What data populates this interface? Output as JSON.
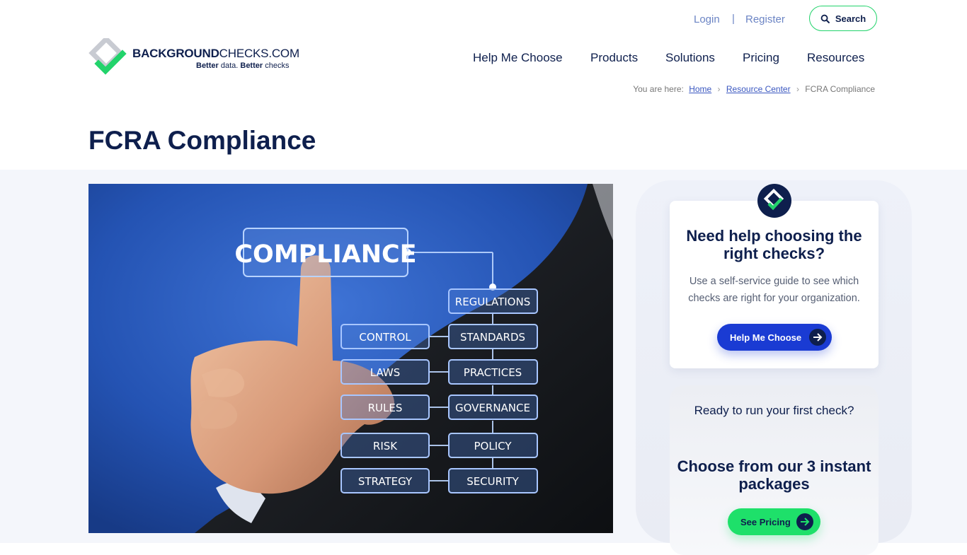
{
  "header": {
    "login_label": "Login",
    "separator": "|",
    "register_label": "Register",
    "search_label": "Search",
    "search_icon": "search-icon"
  },
  "logo": {
    "brand_bold": "BACKGROUND",
    "brand_light": "CHECKS.COM",
    "tagline_a": "Better",
    "tagline_b": " data. ",
    "tagline_c": "Better",
    "tagline_d": " checks",
    "colors": {
      "navy": "#0e1f4d",
      "green": "#22d36b",
      "grey": "#c8cbd2"
    }
  },
  "nav": {
    "items": [
      {
        "label": "Help Me Choose"
      },
      {
        "label": "Products"
      },
      {
        "label": "Solutions"
      },
      {
        "label": "Pricing"
      },
      {
        "label": "Resources"
      }
    ]
  },
  "breadcrumb": {
    "prefix": "You are here:",
    "home": "Home",
    "resource_center": "Resource Center",
    "current": "FCRA Compliance",
    "chevron": "›"
  },
  "page": {
    "title": "FCRA Compliance"
  },
  "hero": {
    "main_label": "COMPLIANCE",
    "left_column": [
      "CONTROL",
      "LAWS",
      "RULES",
      "RISK",
      "STRATEGY"
    ],
    "right_column": [
      "REGULATIONS",
      "STANDARDS",
      "PRACTICES",
      "GOVERNANCE",
      "POLICY",
      "SECURITY"
    ]
  },
  "sidebar": {
    "help_card": {
      "title": "Need help choosing the right checks?",
      "body": "Use a self-service guide to see which checks are right for your organization.",
      "button_label": "Help Me Choose",
      "button_color": "#1a3bd3"
    },
    "pricing_card": {
      "question": "Ready to run your first check?",
      "headline": "Choose from our 3 instant packages",
      "button_label": "See Pricing",
      "button_color": "#1ee06a"
    }
  }
}
